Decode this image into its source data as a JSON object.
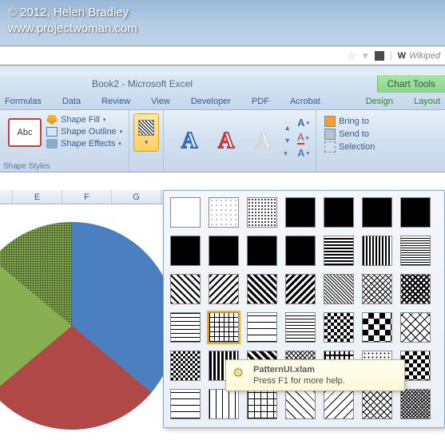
{
  "watermark": {
    "line1": "© 2012, Helen Bradley",
    "line2": "www.projectwoman.com"
  },
  "address_bar": {
    "wiki_prefix": "W",
    "wiki_text": "Wikiped"
  },
  "title": {
    "document": "Book2 - Microsoft Excel",
    "context_tab": "Chart Tools"
  },
  "ribbon_tabs": [
    "Formulas",
    "Data",
    "Review",
    "View",
    "Developer",
    "PDF",
    "Acrobat"
  ],
  "ribbon_tabs_green": [
    "Design",
    "Layout"
  ],
  "shape_styles": {
    "abc": "Abc",
    "fill": "Shape Fill",
    "outline": "Shape Outline",
    "effects": "Shape Effects",
    "group_label": "Shape Styles"
  },
  "arrange": {
    "bring": "Bring to",
    "send": "Send to",
    "selection": "Selection"
  },
  "columns": [
    "E",
    "F",
    "G"
  ],
  "tooltip": {
    "title": "PatternUI.xlam",
    "body": "Press F1 for more help."
  },
  "chart_data": {
    "type": "pie",
    "series": [
      {
        "name": "Blue",
        "value": 36,
        "color": "#4a80c0"
      },
      {
        "name": "Red",
        "value": 28,
        "color": "#b04848"
      },
      {
        "name": "Green",
        "value": 36,
        "color": "#88b050"
      }
    ],
    "title": "",
    "note": "Green slice has crosshatch pattern fill applied (partial)"
  },
  "patterns": [
    "blank",
    "dots-sparse",
    "dots-medium",
    "solid-black",
    "solid-black",
    "solid-black",
    "solid-black",
    "solid-black",
    "solid-black",
    "solid-black",
    "solid-black",
    "horiz-lines",
    "vert-lines",
    "grid-fine",
    "diag-r",
    "diag-l",
    "diag-r-thick",
    "diag-l-thick",
    "diag-dense",
    "diag-grid",
    "diag-grid-thick",
    "horiz-thin",
    "grid-selected",
    "brick",
    "wave",
    "check-small",
    "check-large",
    "diamond",
    "check-bw",
    "stripe",
    "diag-heavy",
    "weave",
    "plaid",
    "confetti",
    "check",
    "horiz-wide",
    "vert-wide",
    "grid-wide",
    "diag-wide",
    "diag-wide-l",
    "crosshatch",
    "crosshatch-fine"
  ]
}
